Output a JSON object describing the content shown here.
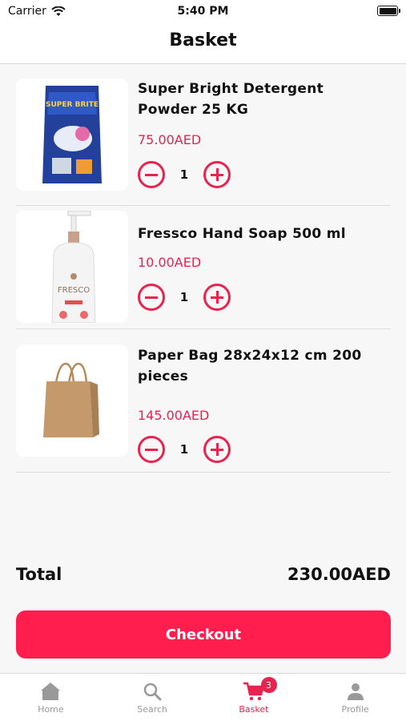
{
  "status": {
    "carrier": "Carrier",
    "time": "5:40 PM"
  },
  "header": {
    "title": "Basket"
  },
  "items": [
    {
      "title": "Super Bright Detergent Powder 25 KG",
      "price": "75.00AED",
      "qty": "1",
      "image_text": "SUPER BRITE"
    },
    {
      "title": "Fressco Hand Soap 500 ml",
      "price": "10.00AED",
      "qty": "1",
      "image_text": "FRESCO"
    },
    {
      "title": "Paper Bag 28x24x12 cm 200 pieces",
      "price": "145.00AED",
      "qty": "1"
    }
  ],
  "total": {
    "label": "Total",
    "value": "230.00AED"
  },
  "checkout_label": "Checkout",
  "tabs": [
    {
      "label": "Home",
      "icon": "home-icon"
    },
    {
      "label": "Search",
      "icon": "search-icon"
    },
    {
      "label": "Basket",
      "icon": "cart-icon",
      "badge": "3",
      "active": true
    },
    {
      "label": "Profile",
      "icon": "profile-icon"
    }
  ],
  "colors": {
    "accent": "#e8234f",
    "button": "#ff1e4e",
    "tab_inactive": "#999999"
  }
}
